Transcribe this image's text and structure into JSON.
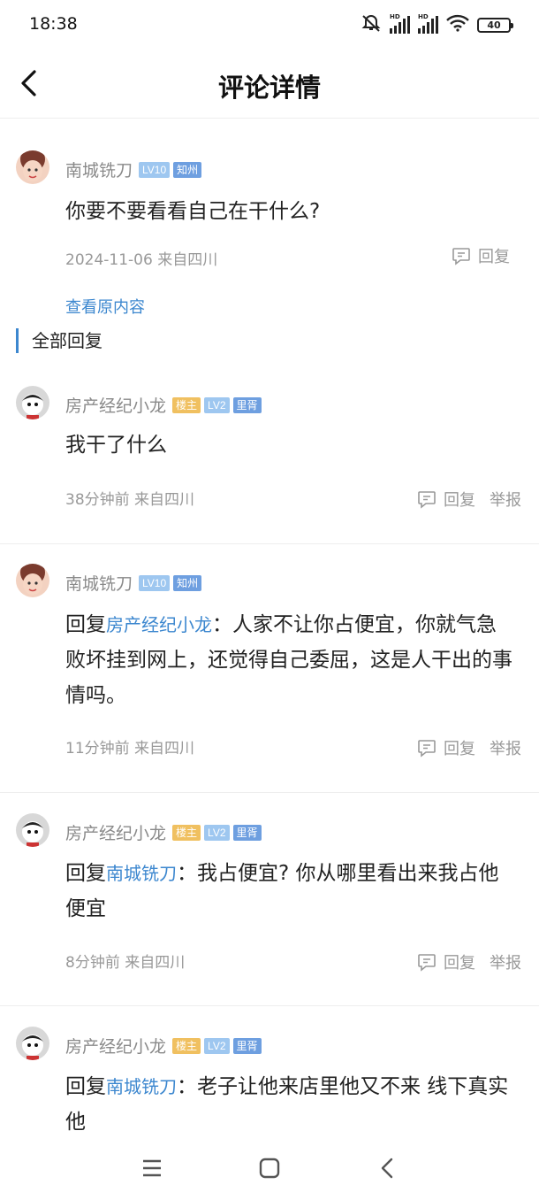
{
  "status_bar": {
    "time": "18:38",
    "battery": "40",
    "icons": [
      "mute-vibrate-icon",
      "signal-hd-icon",
      "signal-hd-icon",
      "wifi-icon",
      "battery-icon"
    ],
    "hd_label": "HD"
  },
  "header": {
    "title": "评论详情",
    "back_icon": "chevron-left-icon"
  },
  "main_comment": {
    "username": "南城铣刀",
    "level": "LV10",
    "region": "知州",
    "content": "你要不要看看自己在干什么?",
    "meta": "2024-11-06 来自四川",
    "reply_label": "回复"
  },
  "view_original": "查看原内容",
  "section_title": "全部回复",
  "replies": [
    {
      "username": "房产经纪小龙",
      "owner_badge": "楼主",
      "level": "LV2",
      "region": "里胥",
      "reply_prefix": "",
      "reply_to": "",
      "content": "我干了什么",
      "meta": "38分钟前 来自四川",
      "reply_label": "回复",
      "report_label": "举报"
    },
    {
      "username": "南城铣刀",
      "owner_badge": "",
      "level": "LV10",
      "region": "知州",
      "reply_prefix": "回复",
      "reply_to": "房产经纪小龙",
      "content": "：人家不让你占便宜，你就气急败坏挂到网上，还觉得自己委屈，这是人干出的事情吗。",
      "meta": "11分钟前 来自四川",
      "reply_label": "回复",
      "report_label": "举报"
    },
    {
      "username": "房产经纪小龙",
      "owner_badge": "楼主",
      "level": "LV2",
      "region": "里胥",
      "reply_prefix": "回复",
      "reply_to": "南城铣刀",
      "content": "：我占便宜? 你从哪里看出来我占他便宜",
      "meta": "8分钟前 来自四川",
      "reply_label": "回复",
      "report_label": "举报"
    },
    {
      "username": "房产经纪小龙",
      "owner_badge": "楼主",
      "level": "LV2",
      "region": "里胥",
      "reply_prefix": "回复",
      "reply_to": "南城铣刀",
      "content": "：老子让他来店里他又不来 线下真实他",
      "meta": "",
      "reply_label": "",
      "report_label": ""
    }
  ],
  "bottom_nav": {
    "icons": [
      "menu-icon",
      "home-icon",
      "back-icon"
    ]
  },
  "colors": {
    "accent": "#3c87cf",
    "level_badge": "#9ec7f0",
    "region_badge": "#6e9fe0",
    "owner_badge": "#f0c060",
    "meta_text": "#999999"
  }
}
